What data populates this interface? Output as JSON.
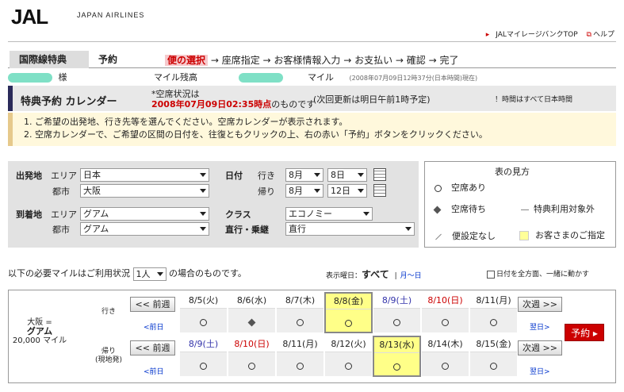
{
  "header": {
    "logo_main": "JAL",
    "logo_sub": "JAPAN AIRLINES",
    "links": [
      "JALマイレージバンクTOP",
      "ヘルプ"
    ]
  },
  "steps": {
    "tab_intl": "国際線特典",
    "tab_reserve": "予約",
    "items": [
      "便の選択",
      "→ 座席指定 → お客様情報入力 → お支払い → 確認 → 完了"
    ]
  },
  "user": {
    "honorific": "様",
    "miles_label": "マイル残高",
    "miles_unit": "マイル",
    "as_of": "(2008年07月09日12時37分(日本時間)現在)"
  },
  "calendar_bar": {
    "title": "特典予約 カレンダー",
    "status_line1": "*空席状況は",
    "status_time": "2008年07月09日02:35時点",
    "status_suffix": "のものです",
    "next_update": "(次回更新は明日午前1時予定)",
    "timezone_note": "！時間はすべて日本時間"
  },
  "instructions": [
    "1. ご希望の出発地、行き先等を選んでください。空席カレンダーが表示されます。",
    "2. 空席カレンダーで、ご希望の区間の日付を、往復ともクリックの上、右の赤い「予約」ボタンをクリックください。"
  ],
  "search": {
    "origin_label": "出発地",
    "dest_label": "到着地",
    "area_label": "エリア",
    "city_label": "都市",
    "origin_area": "日本",
    "origin_city": "大阪",
    "dest_area": "グアム",
    "dest_city": "グアム",
    "date_label": "日付",
    "outbound_label": "行き",
    "return_label": "帰り",
    "out_month": "8月",
    "out_day": "8日",
    "ret_month": "8月",
    "ret_day": "12日",
    "class_label": "クラス",
    "class_value": "エコノミー",
    "nonstop_label": "直行・乗継",
    "nonstop_value": "直行"
  },
  "legend": {
    "title": "表の見方",
    "available": "空席あり",
    "waitlist": "空席待ち",
    "not_eligible": "特典利用対象外",
    "no_flight": "便設定なし",
    "selected": "お客さまのご指定"
  },
  "miles_row": {
    "prefix": "以下の必要マイルはご利用状況",
    "persons": "1人",
    "suffix": "の場合のものです。",
    "weekday_label": "表示曜日：",
    "weekday_value": "すべて",
    "weekday_alt": "月〜日",
    "move_all": "日付を全方面、一緒に動かす"
  },
  "grid": {
    "route_from": "大阪 =",
    "route_to": "グアム",
    "route_miles": "20,000 マイル",
    "outbound": "行き",
    "return": "帰り",
    "return_sub": "(現地発)",
    "prev_week": "<< 前週",
    "next_week": "次週 >>",
    "prev_day": "<前日",
    "next_day": "翌日>",
    "reserve": "予約 ▸",
    "out_days": [
      {
        "date": "8/5(火)",
        "mark": "○",
        "kind": "wd",
        "sel": false
      },
      {
        "date": "8/6(水)",
        "mark": "◆",
        "kind": "wd",
        "sel": false
      },
      {
        "date": "8/7(木)",
        "mark": "○",
        "kind": "wd",
        "sel": false
      },
      {
        "date": "8/8(金)",
        "mark": "○",
        "kind": "wd",
        "sel": true
      },
      {
        "date": "8/9(土)",
        "mark": "○",
        "kind": "sat",
        "sel": false
      },
      {
        "date": "8/10(日)",
        "mark": "○",
        "kind": "sun",
        "sel": false
      },
      {
        "date": "8/11(月)",
        "mark": "○",
        "kind": "wd",
        "sel": false
      }
    ],
    "ret_days": [
      {
        "date": "8/9(土)",
        "mark": "○",
        "kind": "sat",
        "sel": false
      },
      {
        "date": "8/10(日)",
        "mark": "○",
        "kind": "sun",
        "sel": false
      },
      {
        "date": "8/11(月)",
        "mark": "○",
        "kind": "wd",
        "sel": false
      },
      {
        "date": "8/12(火)",
        "mark": "○",
        "kind": "wd",
        "sel": false
      },
      {
        "date": "8/13(水)",
        "mark": "○",
        "kind": "wd",
        "sel": true
      },
      {
        "date": "8/14(木)",
        "mark": "○",
        "kind": "wd",
        "sel": false
      },
      {
        "date": "8/15(金)",
        "mark": "○",
        "kind": "wd",
        "sel": false
      }
    ]
  },
  "colors": {
    "brand_red": "#cc0000",
    "selected_yellow": "#ffff88",
    "accent_navy": "#2b2b5a"
  }
}
